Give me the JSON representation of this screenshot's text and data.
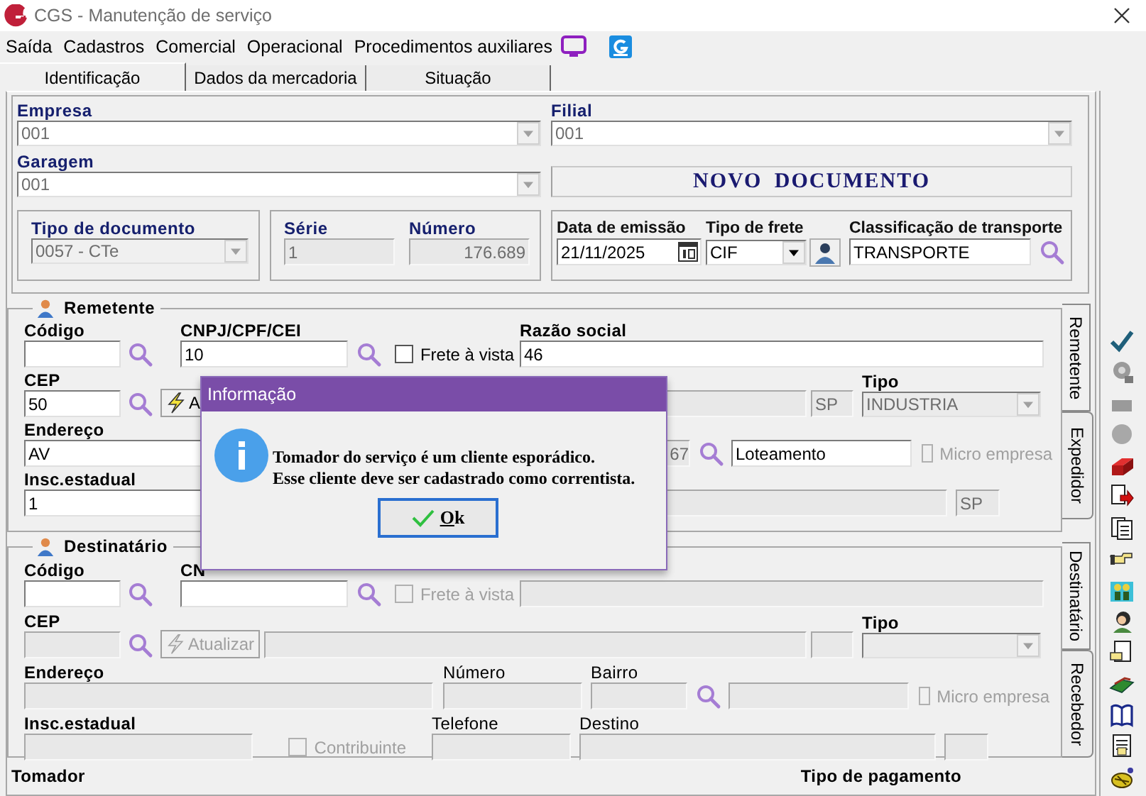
{
  "window": {
    "title": "CGS - Manutenção de serviço"
  },
  "menu": [
    {
      "label": "Saída"
    },
    {
      "label": "Cadastros"
    },
    {
      "label": "Comercial"
    },
    {
      "label": "Operacional"
    },
    {
      "label": "Procedimentos auxiliares"
    }
  ],
  "tabs": [
    {
      "label": "Identificação",
      "selected": true
    },
    {
      "label": "Dados da mercadoria",
      "selected": false
    },
    {
      "label": "Situação",
      "selected": false
    }
  ],
  "header": {
    "empresa": {
      "label": "Empresa",
      "value": "001",
      "disabled": true
    },
    "filial": {
      "label": "Filial",
      "value": "001",
      "disabled": true
    },
    "garagem": {
      "label": "Garagem",
      "value": "001",
      "disabled": true
    },
    "status": "NOVO DOCUMENTO",
    "tipo_documento": {
      "label": "Tipo de documento",
      "value": "0057 - CTe",
      "disabled": true
    },
    "serie": {
      "label": "Série",
      "value": "1",
      "disabled": true
    },
    "numero": {
      "label": "Número",
      "value": "176.689",
      "disabled": true
    },
    "data_emissao": {
      "label": "Data de emissão",
      "value": "21/11/2025"
    },
    "tipo_frete": {
      "label": "Tipo de frete",
      "value": "CIF",
      "disabled": false
    },
    "classificacao": {
      "label": "Classificação de transporte",
      "value": "TRANSPORTE"
    }
  },
  "parties": [
    {
      "title": "Remetente",
      "tabs": [
        {
          "label": "Remetente",
          "selected": true
        },
        {
          "label": "Expedidor",
          "selected": false
        }
      ],
      "fields": [
        {
          "kind": "input",
          "label": "Código",
          "disabled": false
        },
        {
          "kind": "search"
        },
        {
          "kind": "input",
          "label": "CNPJ/CPF/CEI",
          "value": "10",
          "disabled": false
        },
        {
          "kind": "search"
        },
        {
          "kind": "checkbox",
          "label": "Frete à vista",
          "checked": false,
          "disabled": false
        },
        {
          "kind": "input",
          "label": "Razão social",
          "value": "46",
          "disabled": false
        },
        {
          "kind": "input",
          "label": "CEP",
          "value": "50",
          "disabled": false
        },
        {
          "kind": "search"
        },
        {
          "kind": "button",
          "label": "A",
          "disabled": false
        },
        {
          "kind": "input",
          "disabled": true
        },
        {
          "kind": "input",
          "value": "SP",
          "disabled": true
        },
        {
          "kind": "combo",
          "label": "Tipo",
          "value": "INDUSTRIA",
          "disabled": true
        },
        {
          "kind": "input",
          "label": "Endereço",
          "value": "AV",
          "disabled": false
        },
        {
          "kind": "input",
          "value": "67",
          "disabled": true
        },
        {
          "kind": "search"
        },
        {
          "kind": "input",
          "value": "Loteamento",
          "disabled": false
        },
        {
          "kind": "checkbox",
          "label": "Micro empresa",
          "checked": false,
          "disabled": true
        },
        {
          "kind": "input",
          "label": "Insc.estadual",
          "value": "1",
          "disabled": false
        },
        {
          "kind": "input",
          "disabled": true
        },
        {
          "kind": "input",
          "value": "SP",
          "disabled": true
        }
      ]
    },
    {
      "title": "Destinatário",
      "tabs": [
        {
          "label": "Destinatário",
          "selected": true
        },
        {
          "label": "Recebedor",
          "selected": false
        }
      ],
      "fields": [
        {
          "kind": "input",
          "label": "Código",
          "disabled": false
        },
        {
          "kind": "search"
        },
        {
          "kind": "input",
          "label": "CN",
          "disabled": false
        },
        {
          "kind": "search"
        },
        {
          "kind": "checkbox",
          "label": "Frete à vista",
          "checked": false,
          "disabled": true
        },
        {
          "kind": "input",
          "disabled": true
        },
        {
          "kind": "input",
          "label": "CEP",
          "disabled": true
        },
        {
          "kind": "search"
        },
        {
          "kind": "button",
          "label": "Atualizar",
          "disabled": true
        },
        {
          "kind": "input",
          "disabled": true
        },
        {
          "kind": "input",
          "disabled": true
        },
        {
          "kind": "combo",
          "label": "Tipo",
          "disabled": true
        },
        {
          "kind": "input",
          "label": "Endereço",
          "disabled": true
        },
        {
          "kind": "input",
          "label": "Número",
          "disabled": true
        },
        {
          "kind": "input",
          "label": "Bairro",
          "disabled": true
        },
        {
          "kind": "search"
        },
        {
          "kind": "input",
          "disabled": true
        },
        {
          "kind": "checkbox",
          "label": "Micro empresa",
          "checked": false,
          "disabled": true
        },
        {
          "kind": "input",
          "label": "Insc.estadual",
          "disabled": true
        },
        {
          "kind": "checkbox",
          "label": "Contribuinte",
          "checked": false,
          "disabled": true
        },
        {
          "kind": "input",
          "label": "Telefone",
          "disabled": true
        },
        {
          "kind": "input",
          "label": "Destino",
          "disabled": true
        },
        {
          "kind": "input",
          "disabled": true
        }
      ]
    }
  ],
  "footer": [
    {
      "label": "Tomador"
    },
    {
      "label": "Tipo de pagamento"
    }
  ],
  "dialog": {
    "title": "Informação",
    "lines": [
      "Tomador do serviço é um cliente esporádico.",
      "Esse cliente deve ser cadastrado como correntista."
    ],
    "button": "Ok"
  }
}
